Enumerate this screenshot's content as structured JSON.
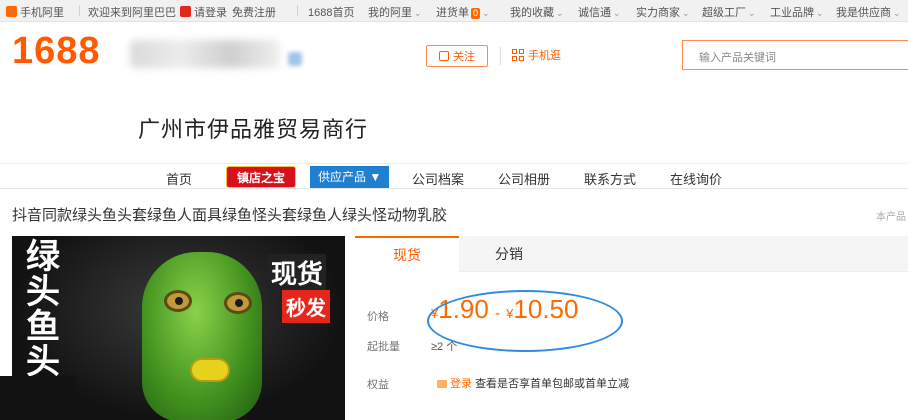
{
  "topbar": {
    "mobile_app": "手机阿里",
    "welcome": "欢迎来到阿里巴巴",
    "login": "请登录",
    "register": "免费注册",
    "home": "1688首页",
    "my_ali": "我的阿里",
    "cart": "进货单",
    "cart_count": "0",
    "favorites": "我的收藏",
    "chengxintong": "诚信通",
    "power_merchant": "实力商家",
    "super_factory": "超级工厂",
    "industrial_brand": "工业品牌",
    "supplier": "我是供应商"
  },
  "header": {
    "logo": "1688",
    "follow": "关注",
    "mobile_shop": "手机逛",
    "search_placeholder": "输入产品关键词"
  },
  "company_name": "广州市伊品雅贸易商行",
  "nav": {
    "home": "首页",
    "shop_treasure": "镇店之宝",
    "supply_products": "供应产品",
    "profile": "公司档案",
    "album": "公司相册",
    "contact": "联系方式",
    "inquiry": "在线询价"
  },
  "product": {
    "title": "抖音同款绿头鱼头套绿鱼人面具绿鱼怪头套绿鱼人绿头怪动物乳胶",
    "side_note": "本产品",
    "image_text_vertical": [
      "绿",
      "头",
      "鱼",
      "头"
    ],
    "image_badge_top": "现货",
    "image_badge_bottom": "秒发"
  },
  "tabs": {
    "active": "现货",
    "other": "分销"
  },
  "pricing": {
    "price_label": "价格",
    "currency": "¥",
    "price_low": "1.90",
    "dash": "-",
    "price_high": "10.50",
    "moq_label": "起批量",
    "moq_value": "≥2 个",
    "rights_label": "权益",
    "rights_login": "登录",
    "rights_text": "查看是否享首单包邮或首单立减"
  },
  "colors": {
    "brand_orange": "#ff5a00",
    "nav_red": "#d7101b",
    "nav_blue": "#1f7fd0",
    "annotation_blue": "#2e8be0"
  }
}
